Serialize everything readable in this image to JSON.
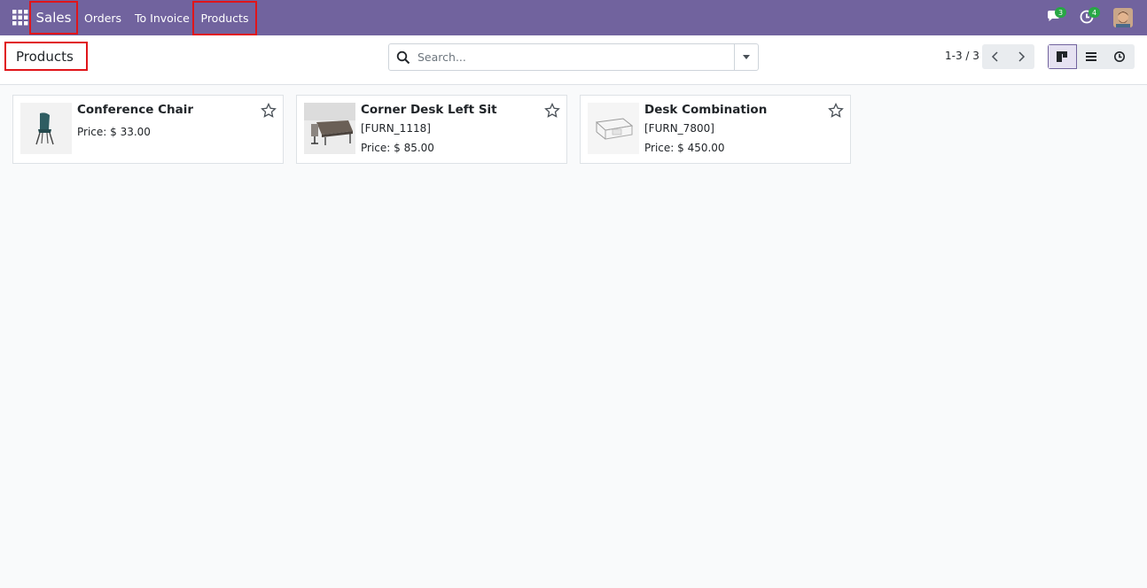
{
  "navbar": {
    "app_name": "Sales",
    "menu": [
      "Orders",
      "To Invoice",
      "Products"
    ],
    "messages_count": "3",
    "activities_count": "4"
  },
  "control": {
    "title": "Products",
    "search_placeholder": "Search...",
    "pager": "1-3 / 3"
  },
  "products": [
    {
      "name": "Conference Chair",
      "ref": "",
      "price": "Price: $ 33.00"
    },
    {
      "name": "Corner Desk Left Sit",
      "ref": "[FURN_1118]",
      "price": "Price: $ 85.00"
    },
    {
      "name": "Desk Combination",
      "ref": "[FURN_7800]",
      "price": "Price: $ 450.00"
    }
  ],
  "colors": {
    "navbar": "#71639e",
    "highlight": "#e0151a",
    "badge": "#28a745"
  }
}
